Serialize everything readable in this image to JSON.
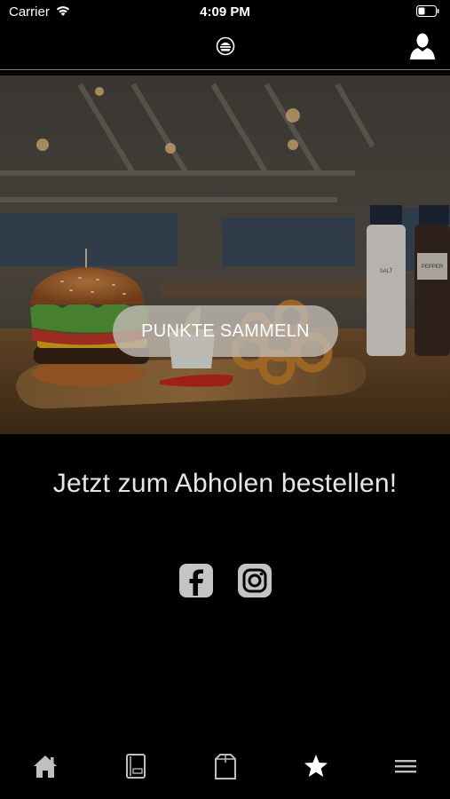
{
  "status_bar": {
    "carrier": "Carrier",
    "time": "4:09 PM",
    "icons": [
      "wifi-icon",
      "battery-icon"
    ]
  },
  "nav_bar": {
    "logo_icon": "burger-logo-icon",
    "profile_icon": "user-profile-icon"
  },
  "hero": {
    "cta_label": "PUNKTE SAMMELN",
    "bottle_labels": [
      "SALT",
      "PEPPER"
    ]
  },
  "main": {
    "headline": "Jetzt zum Abholen bestellen!"
  },
  "social": [
    {
      "name": "facebook-icon"
    },
    {
      "name": "instagram-icon"
    }
  ],
  "tab_bar": {
    "items": [
      {
        "name": "home-icon"
      },
      {
        "name": "menu-book-icon"
      },
      {
        "name": "shopping-bag-icon"
      },
      {
        "name": "star-icon"
      },
      {
        "name": "hamburger-menu-icon"
      }
    ]
  },
  "colors": {
    "background": "#000000",
    "cta_background": "#beb8b0",
    "headline": "#e6e6e6",
    "icon_gray": "#bfbfbf"
  }
}
